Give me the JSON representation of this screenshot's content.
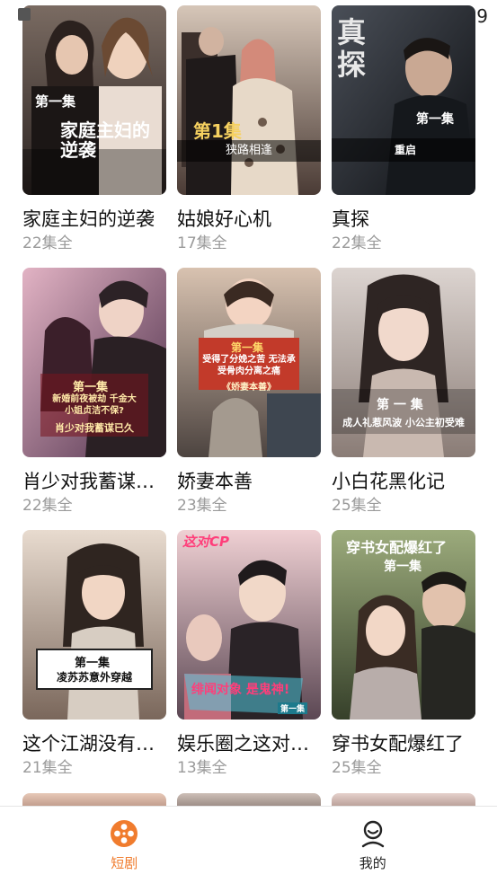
{
  "status": {
    "time": "9"
  },
  "dramas": [
    {
      "title": "家庭主妇的逆袭",
      "count": "22集全",
      "poster_text": "家庭主妇的逆袭",
      "episode": "第一集",
      "colors": [
        "#6b5a52",
        "#2e2622"
      ]
    },
    {
      "title": "姑娘好心机",
      "count": "17集全",
      "poster_text": "狭路相逢",
      "episode": "第1集",
      "colors": [
        "#c7b7a9",
        "#4a3b35"
      ]
    },
    {
      "title": "真探",
      "count": "22集全",
      "poster_text": "真探",
      "episode": "第一集",
      "subtext": "重启",
      "colors": [
        "#3a3f47",
        "#101215"
      ]
    },
    {
      "title": "肖少对我蓄谋…",
      "count": "22集全",
      "poster_text": "肖少对我蓄谋已久",
      "episode": "第一集",
      "subtext": "新婚前夜被劫 千金大小姐贞洁不保?",
      "colors": [
        "#d7a2b6",
        "#5b3d58"
      ]
    },
    {
      "title": "娇妻本善",
      "count": "23集全",
      "poster_text": "《娇妻本善》",
      "episode": "第一集",
      "subtext": "受得了分娩之苦 无法承受骨肉分离之痛",
      "colors": [
        "#c9b5a5",
        "#574a44"
      ]
    },
    {
      "title": "小白花黑化记",
      "count": "25集全",
      "poster_text": "成人礼惹风波 小公主初受难",
      "episode": "第 一 集",
      "colors": [
        "#cfc6c2",
        "#8d7f79"
      ]
    },
    {
      "title": "这个江湖没有…",
      "count": "21集全",
      "poster_text": "凌苏苏意外穿越",
      "episode": "第一集",
      "colors": [
        "#e1d2c6",
        "#7d6b60"
      ]
    },
    {
      "title": "娱乐圈之这对C…",
      "count": "13集全",
      "poster_text": "绯闻对象 是鬼神!",
      "episode": "第一集",
      "subtext": "这对CP",
      "colors": [
        "#e6c4c6",
        "#5e4a57"
      ]
    },
    {
      "title": "穿书女配爆红了",
      "count": "25集全",
      "poster_text": "穿书女配爆红了",
      "episode": "第一集",
      "colors": [
        "#8fa06e",
        "#3e4a2e"
      ]
    }
  ],
  "nav": {
    "tabs": [
      {
        "label": "短剧",
        "icon": "film-reel-icon",
        "active": true
      },
      {
        "label": "我的",
        "icon": "profile-icon",
        "active": false
      }
    ]
  },
  "theme": {
    "accent": "#f07c2e",
    "text": "#111111",
    "muted": "#9a9a9a"
  }
}
